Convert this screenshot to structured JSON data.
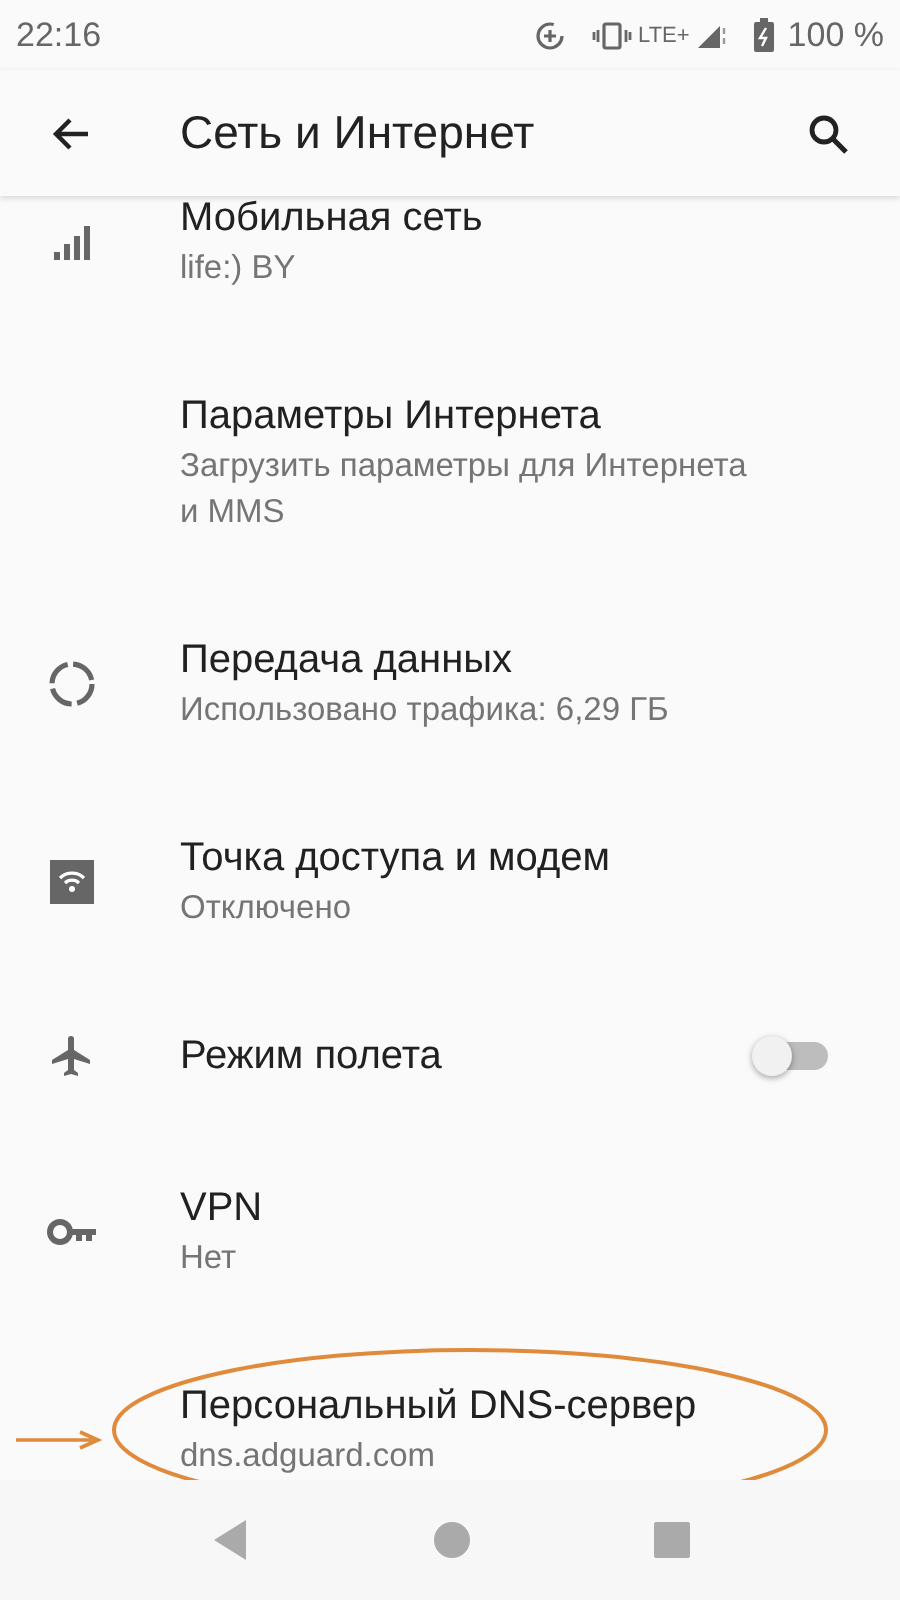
{
  "status_bar": {
    "time": "22:16",
    "network": "LTE+",
    "battery": "100 %"
  },
  "app_bar": {
    "title": "Сеть и Интернет"
  },
  "items": [
    {
      "kind": "signal",
      "title": "Мобильная сеть",
      "subtitle": "life:) BY"
    },
    {
      "kind": "none",
      "title": "Параметры Интернета",
      "subtitle": "Загрузить параметры для Интернета и MMS"
    },
    {
      "kind": "data",
      "title": "Передача данных",
      "subtitle": "Использовано трафика: 6,29 ГБ"
    },
    {
      "kind": "hotspot",
      "title": "Точка доступа и модем",
      "subtitle": "Отключено"
    },
    {
      "kind": "airplane",
      "title": "Режим полета",
      "switch": {
        "on": false
      }
    },
    {
      "kind": "key",
      "title": "VPN",
      "subtitle": "Нет"
    },
    {
      "kind": "none",
      "title": "Персональный DNS-сервер",
      "subtitle": "dns.adguard.com",
      "highlighted": true
    }
  ]
}
